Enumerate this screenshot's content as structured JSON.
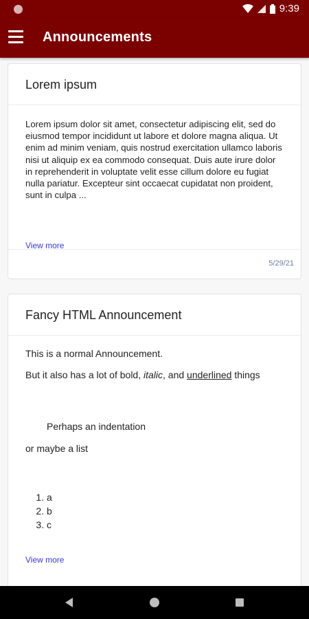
{
  "status_bar": {
    "time": "9:39",
    "icons": [
      "wifi-icon",
      "signal-icon",
      "battery-icon"
    ]
  },
  "app_bar": {
    "title": "Announcements",
    "menu_icon": "menu-icon"
  },
  "announcements": [
    {
      "title": "Lorem ipsum",
      "body": "Lorem ipsum dolor sit amet, consectetur adipiscing elit, sed do eiusmod tempor incididunt ut labore et dolore magna aliqua. Ut enim ad minim veniam, quis nostrud exercitation ullamco laboris nisi ut aliquip ex ea commodo consequat. Duis aute irure dolor in reprehenderit in voluptate velit esse cillum dolore eu fugiat nulla pariatur. Excepteur sint occaecat cupidatat non proident, sunt in culpa ...",
      "view_more": "View more",
      "date": "5/29/21"
    },
    {
      "title": "Fancy HTML Announcement",
      "para1": "This is a normal Announcement.",
      "para2_prefix": "But it also has a lot of bold, ",
      "para2_italic": "italic",
      "para2_mid": ", and ",
      "para2_underline": "underlined",
      "para2_suffix": " things",
      "indent": "Perhaps an indentation",
      "para3": "or maybe a list",
      "list_items": [
        "a",
        "b",
        "c"
      ],
      "view_more": "View more"
    }
  ],
  "nav_bar": {
    "buttons": [
      "back-icon",
      "home-icon",
      "recents-icon"
    ]
  },
  "colors": {
    "primary": "#7b0000",
    "link": "#3a3acc",
    "date": "#6d7e99"
  }
}
